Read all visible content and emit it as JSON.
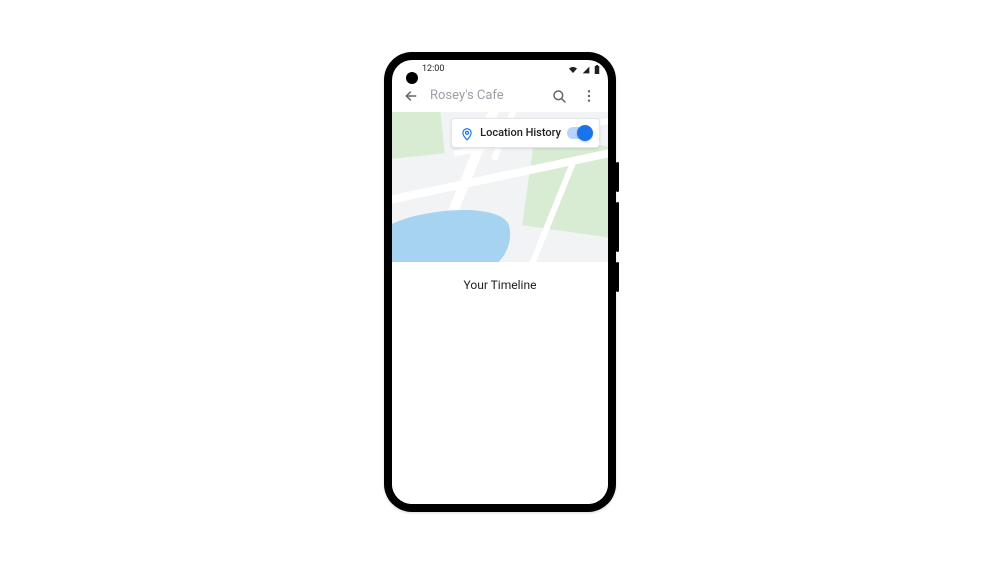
{
  "status": {
    "time": "12:00"
  },
  "appbar": {
    "title": "Rosey's Cafe"
  },
  "card": {
    "label": "Location History",
    "toggle_on": true
  },
  "sheet": {
    "title": "Your Timeline"
  },
  "colors": {
    "accent": "#1a73e8"
  }
}
